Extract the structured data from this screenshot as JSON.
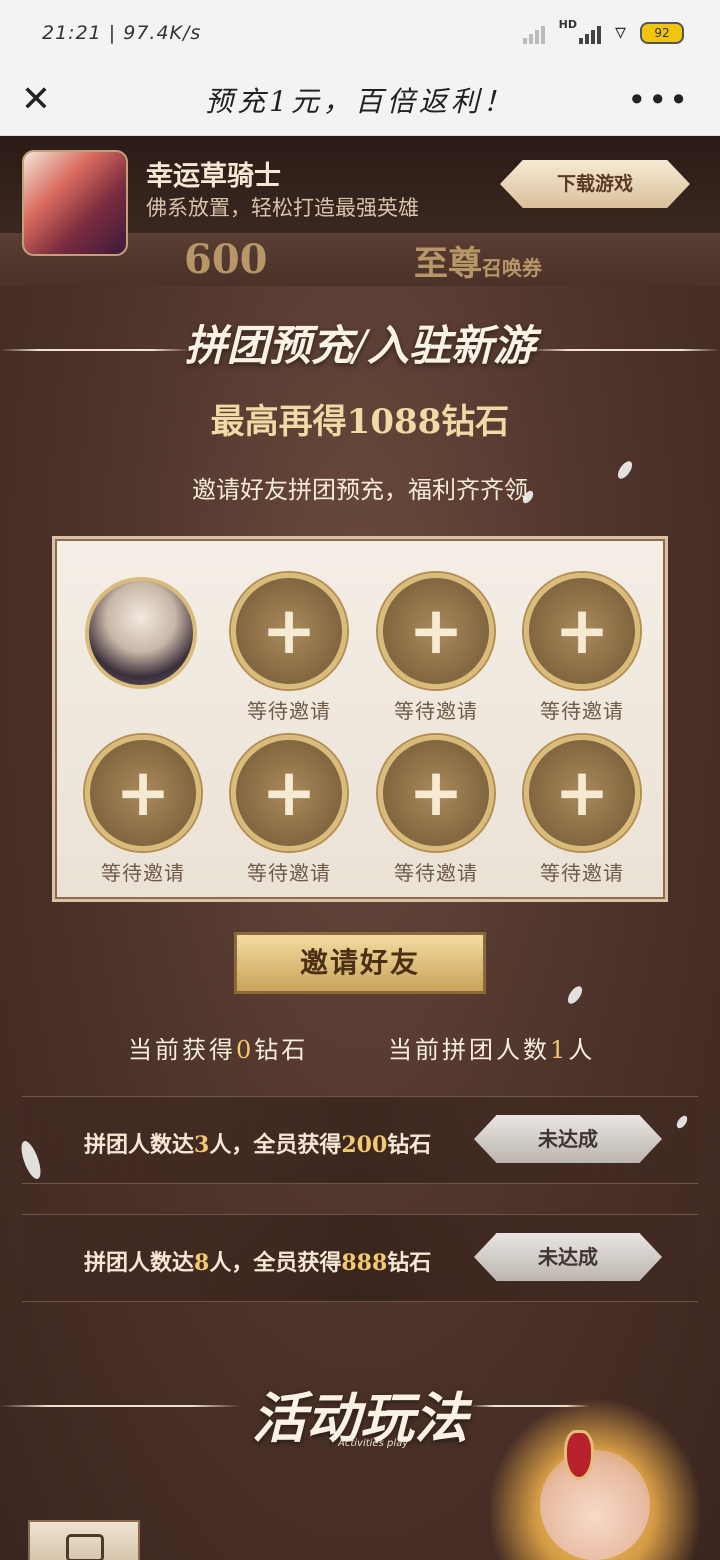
{
  "status_bar": {
    "time": "21:21",
    "speed": "97.4K/s",
    "battery": "92",
    "hd_label": "HD"
  },
  "nav": {
    "title": "预充1元，百倍返利！",
    "close_icon": "close-icon",
    "more_icon": "more-icon"
  },
  "game_banner": {
    "name": "幸运草骑士",
    "description": "佛系放置，轻松打造最强英雄",
    "download_label": "下载游戏"
  },
  "strip": {
    "left_text": "600",
    "right_text": "至尊",
    "right_small": "召唤券"
  },
  "group_section": {
    "title_a": "拼团预充",
    "title_b": "入驻新游",
    "subtitle": "最高再得1088钻石",
    "invite_text": "邀请好友拼团预充，福利齐齐领"
  },
  "invite_slots": [
    {
      "label": "等待邀请"
    },
    {
      "label": "等待邀请"
    },
    {
      "label": "等待邀请"
    },
    {
      "label": "等待邀请"
    },
    {
      "label": "等待邀请"
    },
    {
      "label": "等待邀请"
    },
    {
      "label": "等待邀请"
    }
  ],
  "invite_button": {
    "label": "邀请好友"
  },
  "stats": {
    "diamonds_prefix": "当前获得",
    "diamonds_value": "0",
    "diamonds_unit": "钻石",
    "members_prefix": "当前拼团人数",
    "members_value": "1",
    "members_unit": "人"
  },
  "rewards": [
    {
      "prefix": "拼团人数达",
      "count": "3",
      "middle": "人，全员获得",
      "amount": "200",
      "suffix": "钻石",
      "status": "未达成"
    },
    {
      "prefix": "拼团人数达",
      "count": "8",
      "middle": "人，全员获得",
      "amount": "888",
      "suffix": "钻石",
      "status": "未达成"
    }
  ],
  "activity": {
    "title": "活动玩法",
    "subtitle": "Activities play"
  },
  "colors": {
    "background": "#4a3129",
    "gold": "#f2c870",
    "panel": "#f4eee6"
  }
}
